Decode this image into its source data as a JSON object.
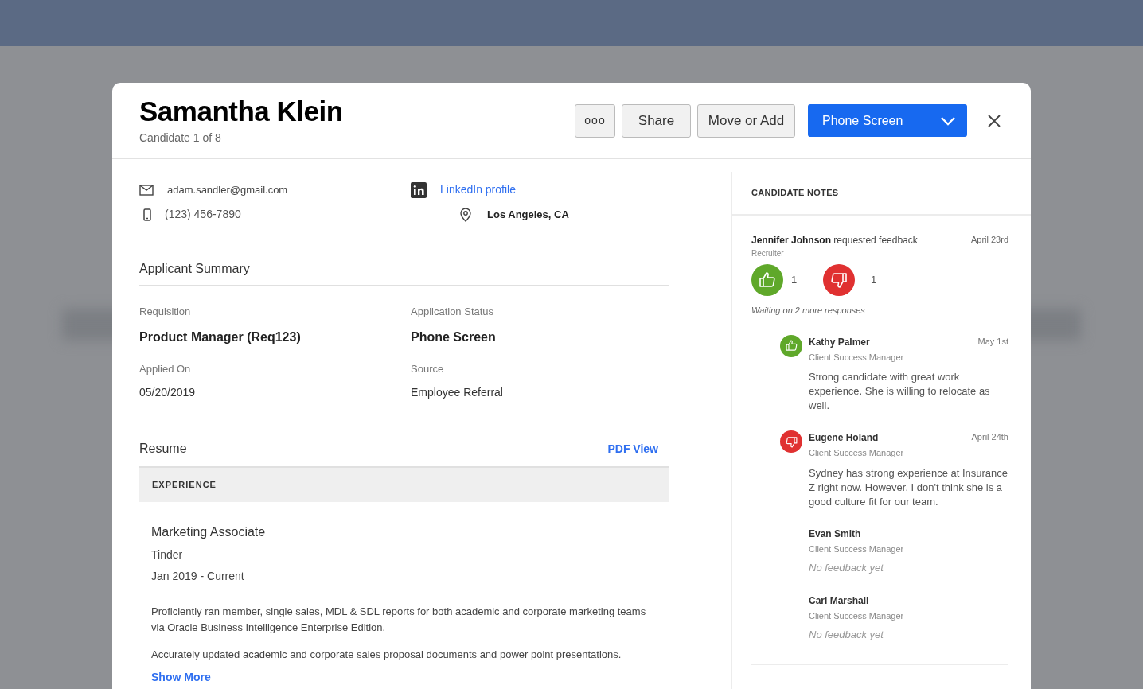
{
  "candidate": {
    "name": "Samantha Klein",
    "position": "Candidate 1 of 8"
  },
  "actions": {
    "more": "ooo",
    "share": "Share",
    "move": "Move or Add",
    "stage": "Phone Screen"
  },
  "contact": {
    "email": "adam.sandler@gmail.com",
    "phone": "(123) 456-7890",
    "linkedin": "LinkedIn profile",
    "location": "Los Angeles, CA"
  },
  "summary": {
    "title": "Applicant Summary",
    "fields": [
      {
        "label": "Requisition",
        "value": "Product Manager (Req123)",
        "emphasis": true
      },
      {
        "label": "Application Status",
        "value": "Phone Screen",
        "emphasis": true
      },
      {
        "label": "Applied On",
        "value": "05/20/2019",
        "emphasis": false
      },
      {
        "label": "Source",
        "value": "Employee Referral",
        "emphasis": false
      }
    ]
  },
  "resume": {
    "title": "Resume",
    "pdf_link": "PDF View",
    "section": "EXPERIENCE",
    "job_title": "Marketing Associate",
    "company": "Tinder",
    "dates": "Jan 2019 - Current",
    "paragraphs": [
      "Proficiently ran member, single sales, MDL & SDL reports for both academic and corporate marketing teams via Oracle Business Intelligence Enterprise Edition.",
      "Accurately updated academic and corporate sales proposal documents and power point presentations."
    ],
    "show_more": "Show More"
  },
  "notes": {
    "title": "CANDIDATE NOTES",
    "request": {
      "requester": "Jennifer Johnson",
      "action": "requested feedback",
      "role": "Recruiter",
      "date": "April 23rd",
      "up_count": "1",
      "down_count": "1",
      "waiting": "Waiting on 2 more responses"
    },
    "responses": [
      {
        "kind": "up",
        "name": "Kathy Palmer",
        "role": "Client Success Manager",
        "date": "May 1st",
        "text": "Strong candidate with great work experience. She is willing to relocate as well."
      },
      {
        "kind": "down",
        "name": "Eugene Holand",
        "role": "Client Success Manager",
        "date": "April 24th",
        "text": "Sydney has strong experience at Insurance Z right now. However, I don't think she is a good culture fit for our team."
      },
      {
        "kind": "none",
        "name": "Evan Smith",
        "role": "Client Success Manager",
        "text": "No feedback yet"
      },
      {
        "kind": "none",
        "name": "Carl Marshall",
        "role": "Client Success Manager",
        "text": "No feedback yet"
      }
    ]
  }
}
